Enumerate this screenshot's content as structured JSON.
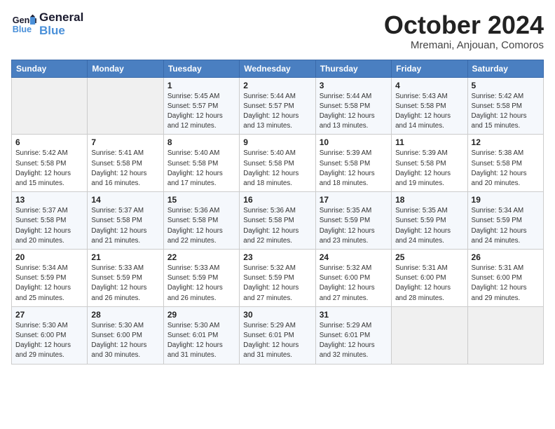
{
  "header": {
    "logo_line1": "General",
    "logo_line2": "Blue",
    "month": "October 2024",
    "location": "Mremani, Anjouan, Comoros"
  },
  "weekdays": [
    "Sunday",
    "Monday",
    "Tuesday",
    "Wednesday",
    "Thursday",
    "Friday",
    "Saturday"
  ],
  "weeks": [
    [
      {
        "day": "",
        "info": ""
      },
      {
        "day": "",
        "info": ""
      },
      {
        "day": "1",
        "info": "Sunrise: 5:45 AM\nSunset: 5:57 PM\nDaylight: 12 hours\nand 12 minutes."
      },
      {
        "day": "2",
        "info": "Sunrise: 5:44 AM\nSunset: 5:57 PM\nDaylight: 12 hours\nand 13 minutes."
      },
      {
        "day": "3",
        "info": "Sunrise: 5:44 AM\nSunset: 5:58 PM\nDaylight: 12 hours\nand 13 minutes."
      },
      {
        "day": "4",
        "info": "Sunrise: 5:43 AM\nSunset: 5:58 PM\nDaylight: 12 hours\nand 14 minutes."
      },
      {
        "day": "5",
        "info": "Sunrise: 5:42 AM\nSunset: 5:58 PM\nDaylight: 12 hours\nand 15 minutes."
      }
    ],
    [
      {
        "day": "6",
        "info": "Sunrise: 5:42 AM\nSunset: 5:58 PM\nDaylight: 12 hours\nand 15 minutes."
      },
      {
        "day": "7",
        "info": "Sunrise: 5:41 AM\nSunset: 5:58 PM\nDaylight: 12 hours\nand 16 minutes."
      },
      {
        "day": "8",
        "info": "Sunrise: 5:40 AM\nSunset: 5:58 PM\nDaylight: 12 hours\nand 17 minutes."
      },
      {
        "day": "9",
        "info": "Sunrise: 5:40 AM\nSunset: 5:58 PM\nDaylight: 12 hours\nand 18 minutes."
      },
      {
        "day": "10",
        "info": "Sunrise: 5:39 AM\nSunset: 5:58 PM\nDaylight: 12 hours\nand 18 minutes."
      },
      {
        "day": "11",
        "info": "Sunrise: 5:39 AM\nSunset: 5:58 PM\nDaylight: 12 hours\nand 19 minutes."
      },
      {
        "day": "12",
        "info": "Sunrise: 5:38 AM\nSunset: 5:58 PM\nDaylight: 12 hours\nand 20 minutes."
      }
    ],
    [
      {
        "day": "13",
        "info": "Sunrise: 5:37 AM\nSunset: 5:58 PM\nDaylight: 12 hours\nand 20 minutes."
      },
      {
        "day": "14",
        "info": "Sunrise: 5:37 AM\nSunset: 5:58 PM\nDaylight: 12 hours\nand 21 minutes."
      },
      {
        "day": "15",
        "info": "Sunrise: 5:36 AM\nSunset: 5:58 PM\nDaylight: 12 hours\nand 22 minutes."
      },
      {
        "day": "16",
        "info": "Sunrise: 5:36 AM\nSunset: 5:58 PM\nDaylight: 12 hours\nand 22 minutes."
      },
      {
        "day": "17",
        "info": "Sunrise: 5:35 AM\nSunset: 5:59 PM\nDaylight: 12 hours\nand 23 minutes."
      },
      {
        "day": "18",
        "info": "Sunrise: 5:35 AM\nSunset: 5:59 PM\nDaylight: 12 hours\nand 24 minutes."
      },
      {
        "day": "19",
        "info": "Sunrise: 5:34 AM\nSunset: 5:59 PM\nDaylight: 12 hours\nand 24 minutes."
      }
    ],
    [
      {
        "day": "20",
        "info": "Sunrise: 5:34 AM\nSunset: 5:59 PM\nDaylight: 12 hours\nand 25 minutes."
      },
      {
        "day": "21",
        "info": "Sunrise: 5:33 AM\nSunset: 5:59 PM\nDaylight: 12 hours\nand 26 minutes."
      },
      {
        "day": "22",
        "info": "Sunrise: 5:33 AM\nSunset: 5:59 PM\nDaylight: 12 hours\nand 26 minutes."
      },
      {
        "day": "23",
        "info": "Sunrise: 5:32 AM\nSunset: 5:59 PM\nDaylight: 12 hours\nand 27 minutes."
      },
      {
        "day": "24",
        "info": "Sunrise: 5:32 AM\nSunset: 6:00 PM\nDaylight: 12 hours\nand 27 minutes."
      },
      {
        "day": "25",
        "info": "Sunrise: 5:31 AM\nSunset: 6:00 PM\nDaylight: 12 hours\nand 28 minutes."
      },
      {
        "day": "26",
        "info": "Sunrise: 5:31 AM\nSunset: 6:00 PM\nDaylight: 12 hours\nand 29 minutes."
      }
    ],
    [
      {
        "day": "27",
        "info": "Sunrise: 5:30 AM\nSunset: 6:00 PM\nDaylight: 12 hours\nand 29 minutes."
      },
      {
        "day": "28",
        "info": "Sunrise: 5:30 AM\nSunset: 6:00 PM\nDaylight: 12 hours\nand 30 minutes."
      },
      {
        "day": "29",
        "info": "Sunrise: 5:30 AM\nSunset: 6:01 PM\nDaylight: 12 hours\nand 31 minutes."
      },
      {
        "day": "30",
        "info": "Sunrise: 5:29 AM\nSunset: 6:01 PM\nDaylight: 12 hours\nand 31 minutes."
      },
      {
        "day": "31",
        "info": "Sunrise: 5:29 AM\nSunset: 6:01 PM\nDaylight: 12 hours\nand 32 minutes."
      },
      {
        "day": "",
        "info": ""
      },
      {
        "day": "",
        "info": ""
      }
    ]
  ]
}
